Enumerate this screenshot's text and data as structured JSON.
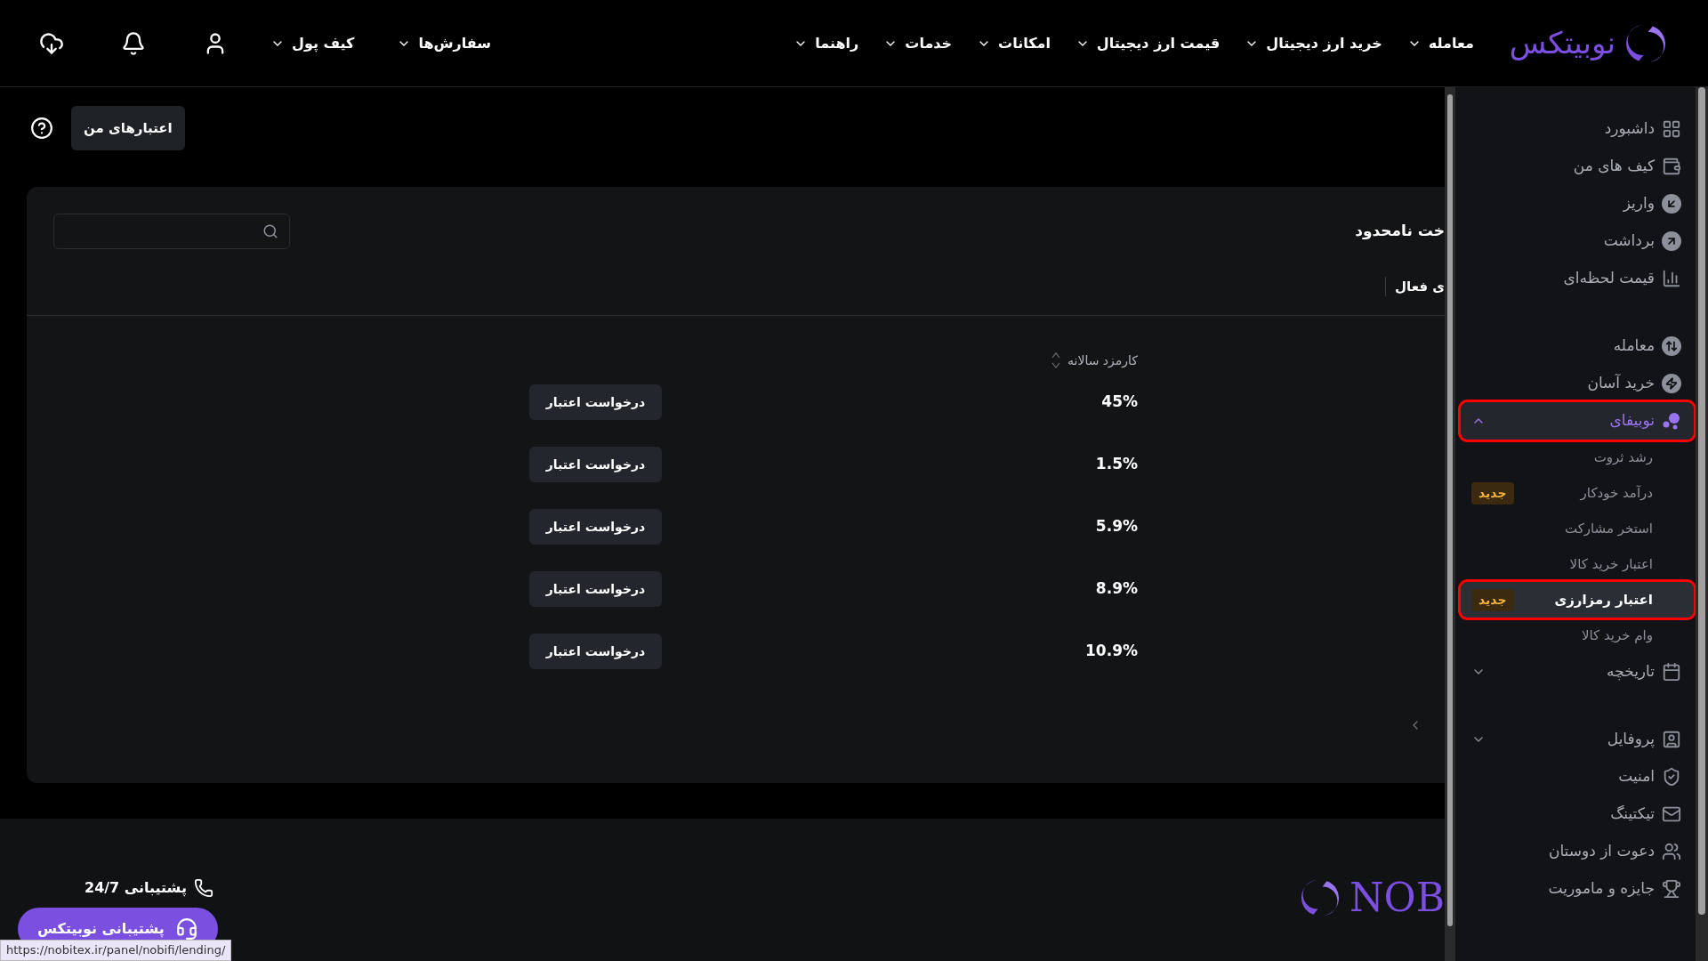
{
  "header": {
    "logo_text": "نوبیتکس",
    "menu": [
      {
        "label": "معامله"
      },
      {
        "label": "خرید ارز دیجیتال"
      },
      {
        "label": "قیمت ارز دیجیتال"
      },
      {
        "label": "امکانات"
      },
      {
        "label": "خدمات"
      },
      {
        "label": "راهنما"
      }
    ],
    "account_menu": [
      {
        "label": "سفارش‌ها"
      },
      {
        "label": "کیف پول"
      }
    ]
  },
  "sidebar": {
    "sections": [
      [
        {
          "label": "داشبورد",
          "kind": "item",
          "selected": false,
          "highlighted": false
        },
        {
          "label": "کیف های من",
          "kind": "item",
          "selected": false,
          "highlighted": false
        },
        {
          "label": "واریز",
          "kind": "item",
          "selected": false,
          "highlighted": false
        },
        {
          "label": "برداشت",
          "kind": "item",
          "selected": false,
          "highlighted": false
        },
        {
          "label": "قیمت لحظه‌ای",
          "kind": "item",
          "selected": false,
          "highlighted": false
        }
      ],
      [
        {
          "label": "معامله",
          "kind": "item",
          "selected": false,
          "highlighted": false
        },
        {
          "label": "خرید آسان",
          "kind": "item",
          "selected": false,
          "highlighted": false
        },
        {
          "label": "نوبیفای",
          "kind": "group",
          "selected": true,
          "highlighted": true,
          "expanded": true,
          "children": [
            {
              "label": "رشد ثروت",
              "selected": false,
              "highlighted": false
            },
            {
              "label": "درآمد خودکار",
              "selected": false,
              "highlighted": false,
              "badge": "جدید"
            },
            {
              "label": "استخر مشارکت",
              "selected": false,
              "highlighted": false
            },
            {
              "label": "اعتبار خرید کالا",
              "selected": false,
              "highlighted": false
            },
            {
              "label": "اعتبار رمزارزی",
              "selected": true,
              "highlighted": true,
              "badge": "جدید"
            },
            {
              "label": "وام خرید کالا",
              "selected": false,
              "highlighted": false
            }
          ]
        },
        {
          "label": "تاریخچه",
          "kind": "group",
          "selected": false,
          "highlighted": false,
          "expanded": false
        }
      ],
      [
        {
          "label": "پروفایل",
          "kind": "group",
          "selected": false,
          "highlighted": false,
          "expanded": false
        },
        {
          "label": "امنیت",
          "kind": "item",
          "selected": false,
          "highlighted": false
        },
        {
          "label": "تیکتینگ",
          "kind": "item",
          "selected": false,
          "highlighted": false
        },
        {
          "label": "دعوت از دوستان",
          "kind": "item",
          "selected": false,
          "highlighted": false
        },
        {
          "label": "جایزه و ماموریت",
          "kind": "item",
          "selected": false,
          "highlighted": false
        }
      ]
    ]
  },
  "page": {
    "tab_button": "اعتبارهای من"
  },
  "card": {
    "title": "خت نامحدود",
    "tab": "ی فعال"
  },
  "table": {
    "columns": [
      "کارمزد سالانه"
    ],
    "rows": [
      {
        "fee": "45%",
        "action": "درخواست اعتبار"
      },
      {
        "fee": "1.5%",
        "action": "درخواست اعتبار"
      },
      {
        "fee": "5.9%",
        "action": "درخواست اعتبار"
      },
      {
        "fee": "8.9%",
        "action": "درخواست اعتبار"
      },
      {
        "fee": "10.9%",
        "action": "درخواست اعتبار"
      }
    ]
  },
  "footer": {
    "logo_text": "NOB",
    "support_label": "پشتیبانی 24/7",
    "support_button": "پشتیبانی نوبیتکس"
  },
  "status_url": "https://nobitex.ir/panel/nobifi/lending/"
}
